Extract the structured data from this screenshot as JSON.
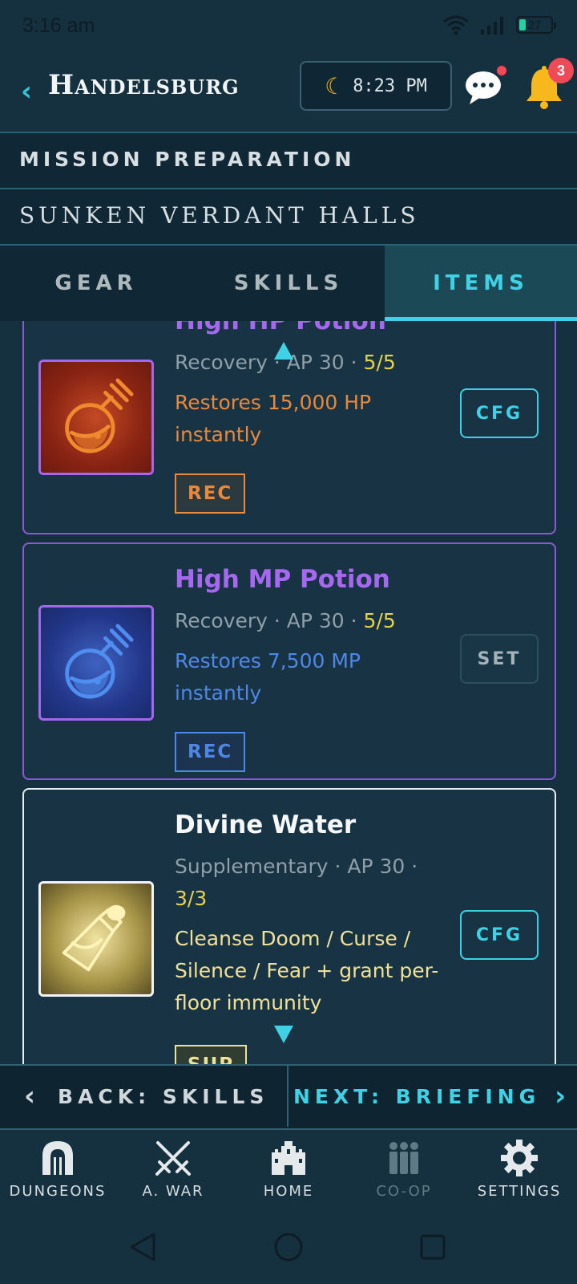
{
  "status_bar": {
    "time": "3:16 am",
    "battery": "27"
  },
  "header": {
    "back_label": "‹",
    "city": "Handelsburg",
    "clock_time": "8:23 PM",
    "notification_count": "3"
  },
  "mission": {
    "title": "MISSION PREPARATION",
    "location": "SUNKEN VERDANT HALLS"
  },
  "tabs": [
    {
      "label": "GEAR",
      "active": false
    },
    {
      "label": "SKILLS",
      "active": false
    },
    {
      "label": "ITEMS",
      "active": true
    }
  ],
  "items": [
    {
      "name": "High HP Potion",
      "meta_prefix": "Recovery · AP 30 · ",
      "stock": "5/5",
      "description": "Restores 15,000 HP instantly",
      "tag": "REC",
      "action": "CFG",
      "icon": "red-potion-icon"
    },
    {
      "name": "High MP Potion",
      "meta_prefix": "Recovery · AP 30 · ",
      "stock": "5/5",
      "description": "Restores 7,500 MP instantly",
      "tag": "REC",
      "action": "SET",
      "icon": "blue-potion-icon"
    },
    {
      "name": "Divine Water",
      "meta_prefix": "Supplementary · AP 30 · ",
      "stock": "3/3",
      "description": "Cleanse Doom / Curse / Silence / Fear + grant per-floor immunity",
      "tag": "SUP",
      "action": "CFG",
      "icon": "divine-water-bottle-icon"
    }
  ],
  "steps": {
    "back": "BACK: SKILLS",
    "next": "NEXT: BRIEFING"
  },
  "bottom_nav": [
    {
      "label": "DUNGEONS",
      "icon": "dungeon-gate-icon"
    },
    {
      "label": "A. WAR",
      "icon": "crossed-swords-icon"
    },
    {
      "label": "HOME",
      "icon": "castle-icon"
    },
    {
      "label": "CO-OP",
      "icon": "group-icon",
      "disabled": true
    },
    {
      "label": "SETTINGS",
      "icon": "gear-icon"
    }
  ],
  "colors": {
    "accent": "#3fd2e6",
    "epic_border": "#8e57d8",
    "recovery_hp": "#e8893c",
    "recovery_mp": "#4f87e6",
    "supplementary": "#efe197",
    "stock": "#e7d34b",
    "badge": "#ef4a57"
  }
}
